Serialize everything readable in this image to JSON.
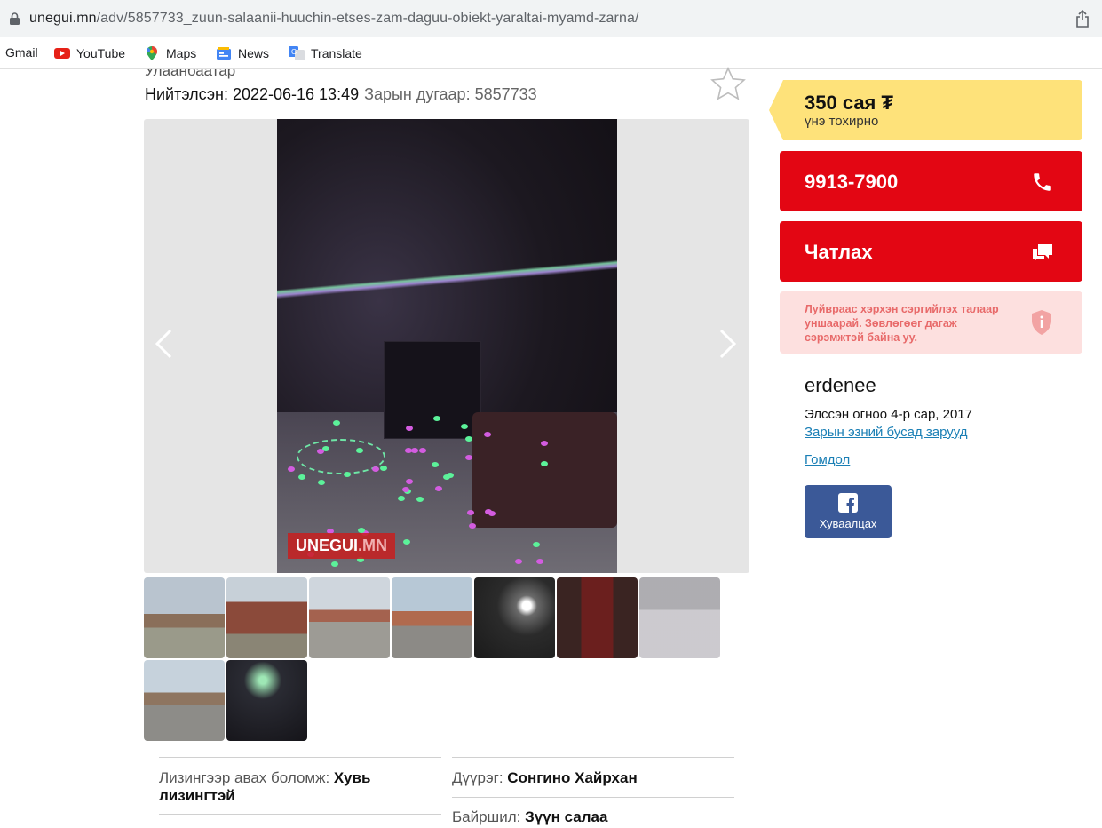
{
  "browser": {
    "url_host": "unegui.mn",
    "url_path": "/adv/5857733_zuun-salaanii-huuchin-etses-zam-daguu-obiekt-yaraltai-myamd-zarna/",
    "bookmarks": [
      {
        "label": "Gmail",
        "icon": "gmail-icon"
      },
      {
        "label": "YouTube",
        "icon": "youtube-icon"
      },
      {
        "label": "Maps",
        "icon": "maps-icon"
      },
      {
        "label": "News",
        "icon": "news-icon"
      },
      {
        "label": "Translate",
        "icon": "translate-icon"
      }
    ]
  },
  "listing": {
    "city": "Улаанбаатар",
    "published": "Нийтэлсэн: 2022-06-16 13:49",
    "ad_number": "Зарын дугаар: 5857733",
    "watermark_a": "UNEGUI",
    "watermark_b": ".MN",
    "thumbnail_count": 9,
    "details": [
      {
        "label": "Лизингээр авах боломж: ",
        "value": "Хувь лизингтэй"
      },
      {
        "label": "Дүүрэг: ",
        "value": "Сонгино Хайрхан"
      },
      {
        "label": "Байршил: ",
        "value": "Зүүн салаа"
      }
    ]
  },
  "sidebar": {
    "price": "350 сая ₮",
    "negotiable": "үнэ тохирно",
    "phone": "9913-7900",
    "chat": "Чатлах",
    "warning": "Луйвраас хэрхэн сэргийлэх талаар уншаарай. Зөвлөгөөг дагаж сэрэмжтэй байна уу.",
    "seller_name": "erdenee",
    "joined": "Элссэн огноо 4-р сар, 2017",
    "other_ads": "Зарын эзний бусад зарууд",
    "complain": "Гомдол",
    "share": "Хуваалцах"
  },
  "colors": {
    "price_bg": "#fee27a",
    "red": "#e30613",
    "warn_bg": "#fde0df",
    "facebook": "#3b5998",
    "link": "#1a7fb5"
  }
}
